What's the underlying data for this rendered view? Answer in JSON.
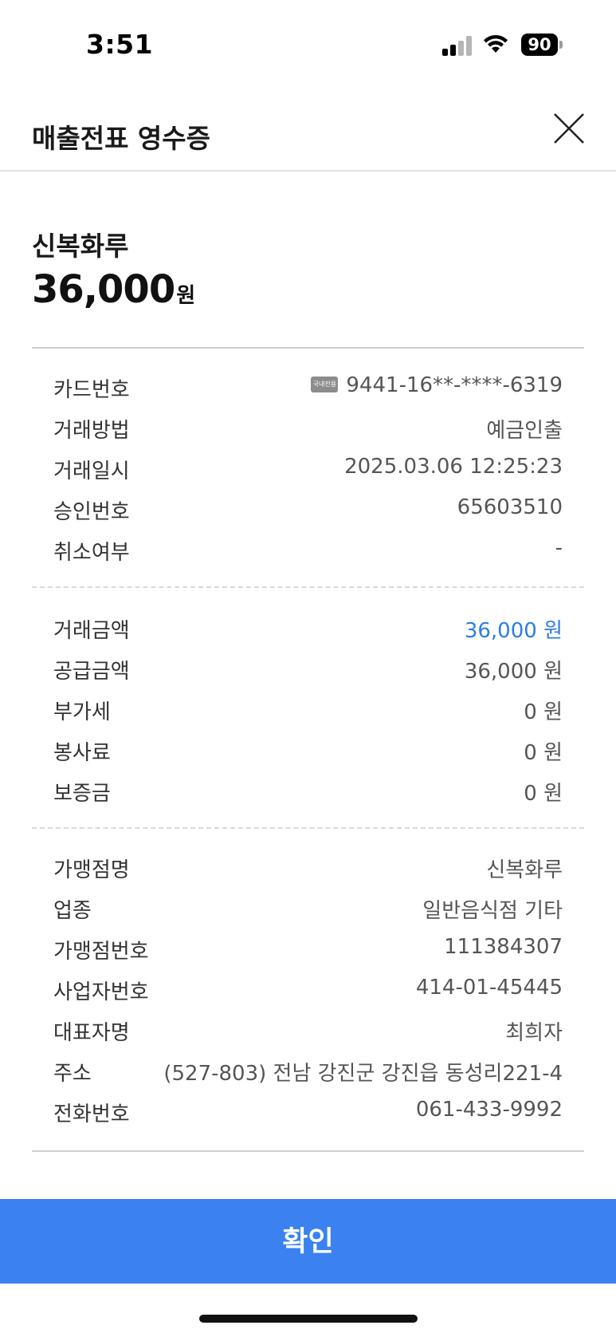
{
  "status_bar": {
    "time": "3:51",
    "battery": "90",
    "icons": [
      "signal-icon",
      "wifi-icon",
      "battery-icon"
    ]
  },
  "header": {
    "title": "매출전표 영수증",
    "close_icon": "close-icon"
  },
  "summary": {
    "merchant_name": "신복화루",
    "amount": "36,000",
    "unit": "원"
  },
  "card_section": {
    "rows": [
      {
        "label": "카드번호",
        "value": "9441-16**-****-6319",
        "chip": "국내전용"
      },
      {
        "label": "거래방법",
        "value": "예금인출"
      },
      {
        "label": "거래일시",
        "value": "2025.03.06 12:25:23"
      },
      {
        "label": "승인번호",
        "value": "65603510"
      },
      {
        "label": "취소여부",
        "value": "-"
      }
    ]
  },
  "amount_section": {
    "rows": [
      {
        "label": "거래금액",
        "value": "36,000 원"
      },
      {
        "label": "공급금액",
        "value": "36,000 원"
      },
      {
        "label": "부가세",
        "value": "0 원"
      },
      {
        "label": "봉사료",
        "value": "0 원"
      },
      {
        "label": "보증금",
        "value": "0 원"
      }
    ]
  },
  "merchant_section": {
    "rows": [
      {
        "label": "가맹점명",
        "value": "신복화루"
      },
      {
        "label": "업종",
        "value": "일반음식점 기타"
      },
      {
        "label": "가맹점번호",
        "value": "111384307"
      },
      {
        "label": "사업자번호",
        "value": "414-01-45445"
      },
      {
        "label": "대표자명",
        "value": "최희자"
      },
      {
        "label": "주소",
        "value": "(527-803) 전남 강진군 강진읍 동성리221-4"
      },
      {
        "label": "전화번호",
        "value": "061-433-9992"
      }
    ]
  },
  "footer": {
    "confirm_label": "확인"
  },
  "colors": {
    "accent_blue": "#3b82f0",
    "amount_blue": "#2d7de6"
  }
}
